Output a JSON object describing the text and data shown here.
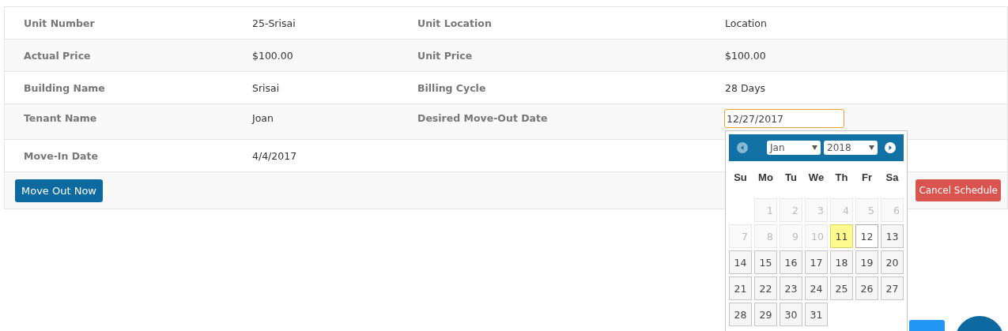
{
  "details": {
    "rows": [
      {
        "cells": [
          {
            "label": "Unit Number",
            "value": "25-Srisai"
          },
          {
            "label": "Unit Location",
            "value": "Location"
          }
        ]
      },
      {
        "cells": [
          {
            "label": "Actual Price",
            "value": "$100.00"
          },
          {
            "label": "Unit Price",
            "value": "$100.00"
          }
        ]
      },
      {
        "cells": [
          {
            "label": "Building Name",
            "value": "Srisai"
          },
          {
            "label": "Billing Cycle",
            "value": "28 Days"
          }
        ]
      },
      {
        "cells": [
          {
            "label": "Tenant Name",
            "value": "Joan"
          },
          {
            "label": "Desired Move-Out Date",
            "kind": "date-field",
            "value": "12/27/2017",
            "focused": true
          }
        ]
      },
      {
        "cells": [
          {
            "label": "Move-In Date",
            "value": "4/4/2017"
          }
        ]
      }
    ]
  },
  "actions": {
    "move_out_button": "Move Out Now",
    "cancel_button": "Cancel Schedule"
  },
  "datepicker": {
    "prev_disabled": true,
    "month": "Jan",
    "year": "2018",
    "weekdays": [
      "Su",
      "Mo",
      "Tu",
      "We",
      "Th",
      "Fr",
      "Sa"
    ],
    "weeks": [
      {
        "days": [
          {
            "day": "1",
            "disabled": true,
            "today": false,
            "hover": false
          },
          {
            "day": "2",
            "disabled": true,
            "today": false,
            "hover": false
          },
          {
            "day": "3",
            "disabled": true,
            "today": false,
            "hover": false
          },
          {
            "day": "4",
            "disabled": true,
            "today": false,
            "hover": false
          },
          {
            "day": "5",
            "disabled": true,
            "today": false,
            "hover": false
          },
          {
            "day": "6",
            "disabled": true,
            "today": false,
            "hover": false
          }
        ]
      },
      {
        "days": [
          {
            "day": "7",
            "disabled": true,
            "today": false,
            "hover": false
          },
          {
            "day": "8",
            "disabled": true,
            "today": false,
            "hover": false
          },
          {
            "day": "9",
            "disabled": true,
            "today": false,
            "hover": false
          },
          {
            "day": "10",
            "disabled": true,
            "today": false,
            "hover": false
          },
          {
            "day": "11",
            "disabled": false,
            "today": true,
            "hover": false
          },
          {
            "day": "12",
            "disabled": false,
            "today": false,
            "hover": true
          },
          {
            "day": "13",
            "disabled": false,
            "today": false,
            "hover": false
          }
        ]
      },
      {
        "days": [
          {
            "day": "14",
            "disabled": false,
            "today": false,
            "hover": false
          },
          {
            "day": "15",
            "disabled": false,
            "today": false,
            "hover": false
          },
          {
            "day": "16",
            "disabled": false,
            "today": false,
            "hover": false
          },
          {
            "day": "17",
            "disabled": false,
            "today": false,
            "hover": false
          },
          {
            "day": "18",
            "disabled": false,
            "today": false,
            "hover": false
          },
          {
            "day": "19",
            "disabled": false,
            "today": false,
            "hover": false
          },
          {
            "day": "20",
            "disabled": false,
            "today": false,
            "hover": false
          }
        ]
      },
      {
        "days": [
          {
            "day": "21",
            "disabled": false,
            "today": false,
            "hover": false
          },
          {
            "day": "22",
            "disabled": false,
            "today": false,
            "hover": false
          },
          {
            "day": "23",
            "disabled": false,
            "today": false,
            "hover": false
          },
          {
            "day": "24",
            "disabled": false,
            "today": false,
            "hover": false
          },
          {
            "day": "25",
            "disabled": false,
            "today": false,
            "hover": false
          },
          {
            "day": "26",
            "disabled": false,
            "today": false,
            "hover": false
          },
          {
            "day": "27",
            "disabled": false,
            "today": false,
            "hover": false
          }
        ]
      },
      {
        "days": [
          {
            "day": "28",
            "disabled": false,
            "today": false,
            "hover": false
          },
          {
            "day": "29",
            "disabled": false,
            "today": false,
            "hover": false
          },
          {
            "day": "30",
            "disabled": false,
            "today": false,
            "hover": false
          },
          {
            "day": "31",
            "disabled": false,
            "today": false,
            "hover": false
          }
        ]
      }
    ]
  }
}
